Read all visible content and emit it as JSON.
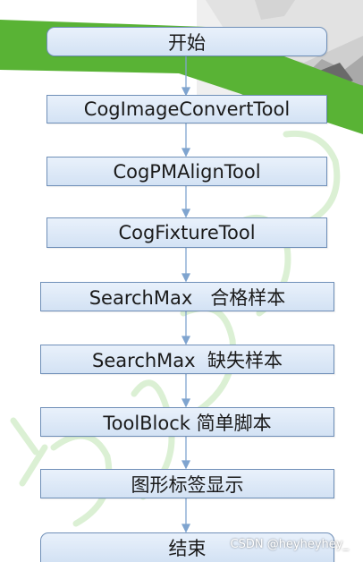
{
  "flow": {
    "steps": [
      "开始",
      "CogImageConvertTool",
      "CogPMAlignTool",
      "CogFixtureTool",
      "SearchMax   合格样本",
      "SearchMax  缺失样本",
      "ToolBlock 简单脚本",
      "图形标签显示",
      "结束"
    ]
  },
  "watermark": "CSDN @heyheyhey_",
  "colors": {
    "box_fill": "#dce8f6",
    "box_border": "#6f8fb8",
    "arrow": "#7fa4cf",
    "green_band": "#59b335"
  }
}
